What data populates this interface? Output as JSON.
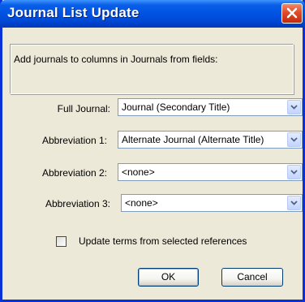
{
  "window": {
    "title": "Journal List Update"
  },
  "description": "Add journals to columns in Journals from fields:",
  "fields": [
    {
      "label": "Full Journal:",
      "value": "Journal (Secondary Title)"
    },
    {
      "label": "Abbreviation 1:",
      "value": "Alternate Journal (Alternate Title)"
    },
    {
      "label": "Abbreviation 2:",
      "value": "<none>"
    },
    {
      "label": "Abbreviation 3:",
      "value": "<none>"
    }
  ],
  "checkbox": {
    "label": "Update terms from selected references",
    "checked": false
  },
  "buttons": {
    "ok": "OK",
    "cancel": "Cancel"
  },
  "icons": {
    "close": "close-icon",
    "dropdown": "chevron-down-icon"
  },
  "colors": {
    "titlebar": "#0054e3",
    "close": "#e04a2a",
    "dialog_bg": "#ece9d8",
    "combo_border": "#7f9db9"
  }
}
